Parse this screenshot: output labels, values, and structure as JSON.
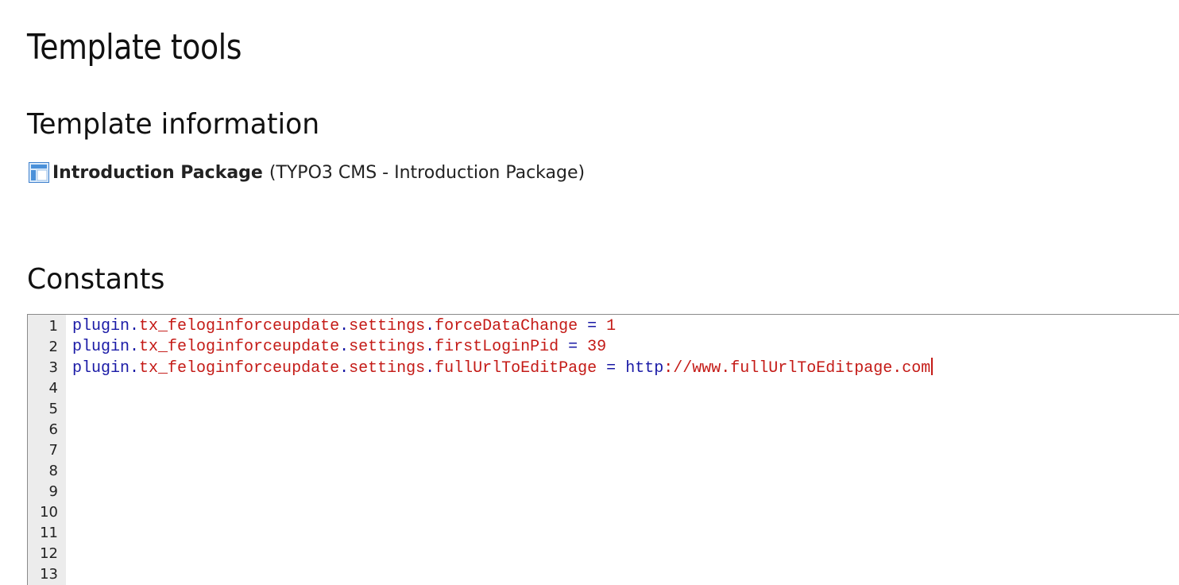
{
  "page": {
    "title": "Template tools"
  },
  "template_info": {
    "heading": "Template information",
    "icon": "template-icon",
    "name": "Introduction Package",
    "description": "(TYPO3 CMS - Introduction Package)"
  },
  "constants": {
    "heading": "Constants",
    "line_numbers": [
      "1",
      "2",
      "3",
      "4",
      "5",
      "6",
      "7",
      "8",
      "9",
      "10",
      "11",
      "12",
      "13"
    ],
    "lines": [
      {
        "obj": "plugin",
        "dot1": ".",
        "ext": "tx_feloginforceupdate",
        "dot2": ".",
        "group": "settings",
        "dot3": ".",
        "key": "forceDataChange",
        "op": " = ",
        "value_proto": "",
        "value": "1"
      },
      {
        "obj": "plugin",
        "dot1": ".",
        "ext": "tx_feloginforceupdate",
        "dot2": ".",
        "group": "settings",
        "dot3": ".",
        "key": "firstLoginPid",
        "op": " = ",
        "value_proto": "",
        "value": "39"
      },
      {
        "obj": "plugin",
        "dot1": ".",
        "ext": "tx_feloginforceupdate",
        "dot2": ".",
        "group": "settings",
        "dot3": ".",
        "key": "fullUrlToEditPage",
        "op": " = ",
        "value_proto": "http",
        "value": "://www.fullUrlToEditpage.com"
      }
    ]
  },
  "colors": {
    "object": "#1a1aa6",
    "property": "#c41a16",
    "gutter": "#ececec",
    "icon_blue": "#4a90d9"
  }
}
